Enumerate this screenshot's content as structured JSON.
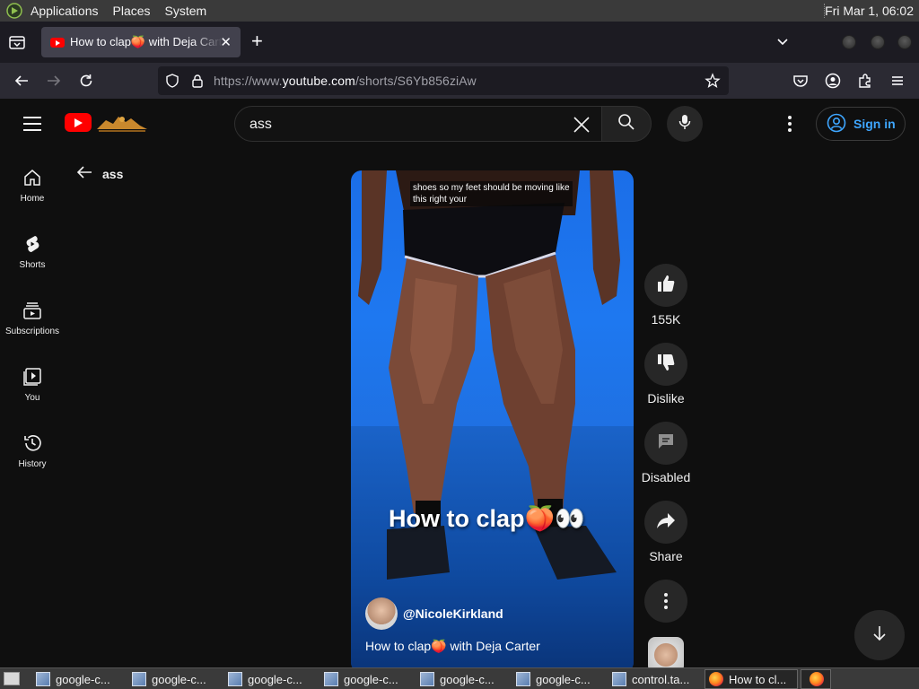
{
  "gnome_panel": {
    "menus": [
      "Applications",
      "Places",
      "System"
    ],
    "clock": "Fri Mar  1, 06:02"
  },
  "browser": {
    "tab_title": "How to clap🍑 with Deja Carter",
    "url_prefix": "https://www.",
    "url_domain": "youtube.com",
    "url_path": "/shorts/S6Yb856ziAw"
  },
  "youtube": {
    "search_query": "ass",
    "sign_in_label": "Sign in",
    "back_query": "ass",
    "sidebar": [
      {
        "label": "Home",
        "icon": "home-icon"
      },
      {
        "label": "Shorts",
        "icon": "shorts-icon"
      },
      {
        "label": "Subscriptions",
        "icon": "subscriptions-icon"
      },
      {
        "label": "You",
        "icon": "you-icon"
      },
      {
        "label": "History",
        "icon": "history-icon"
      }
    ],
    "short": {
      "caption_line1": "shoes so my feet should be moving like",
      "caption_line2": "this right your",
      "overlay_title": "How to clap🍑👀",
      "channel": "@NicoleKirkland",
      "title": "How to clap🍑 with Deja Carter"
    },
    "actions": {
      "likes": "155K",
      "dislike": "Dislike",
      "comments": "Disabled",
      "share": "Share"
    }
  },
  "taskbar": {
    "tasks": [
      {
        "label": "google-c...",
        "icon": "terminal-icon",
        "active": false
      },
      {
        "label": "google-c...",
        "icon": "terminal-icon",
        "active": false
      },
      {
        "label": "google-c...",
        "icon": "terminal-icon",
        "active": false
      },
      {
        "label": "google-c...",
        "icon": "terminal-icon",
        "active": false
      },
      {
        "label": "google-c...",
        "icon": "terminal-icon",
        "active": false
      },
      {
        "label": "google-c...",
        "icon": "terminal-icon",
        "active": false
      },
      {
        "label": "control.ta...",
        "icon": "terminal-icon",
        "active": false
      },
      {
        "label": "How to cl...",
        "icon": "firefox-icon",
        "active": true
      }
    ]
  },
  "colors": {
    "youtube_red": "#ff0000",
    "link_blue": "#3ea6ff",
    "page_bg": "#0f0f0f"
  }
}
